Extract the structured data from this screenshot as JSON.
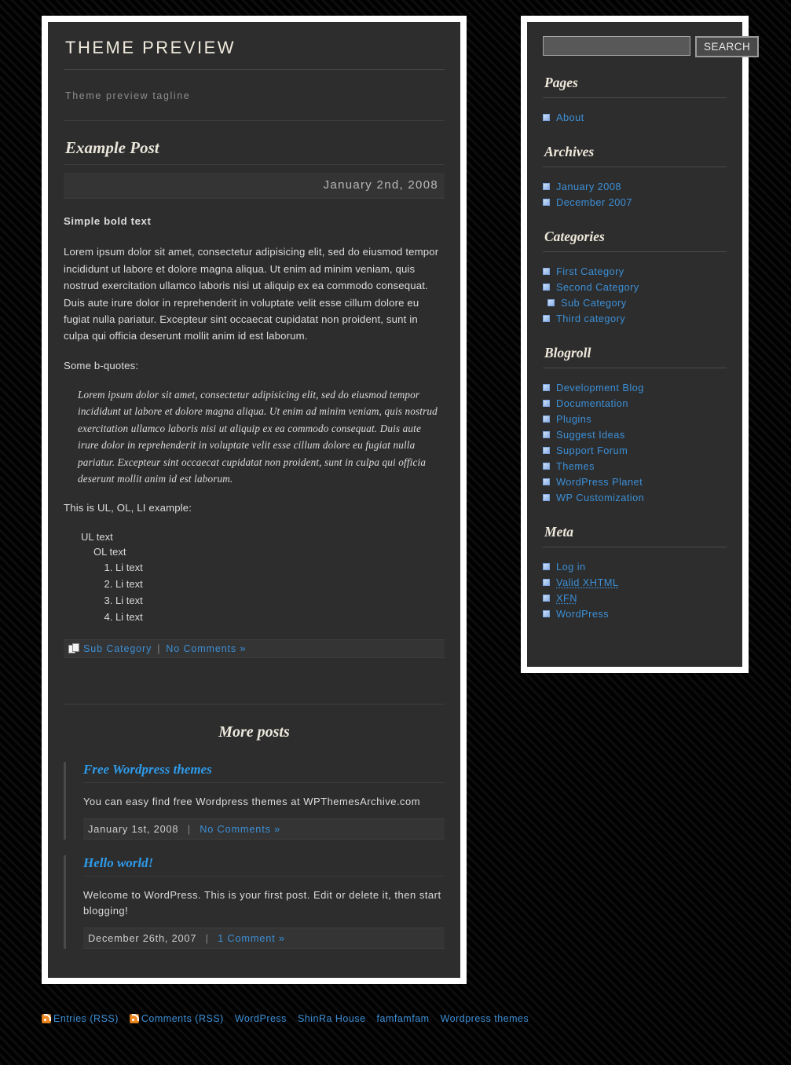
{
  "site": {
    "title": "THEME PREVIEW",
    "tagline": "Theme preview tagline"
  },
  "post": {
    "title": "Example Post",
    "date": "January 2nd, 2008",
    "bold_line": "Simple bold text",
    "paragraph": "Lorem ipsum dolor sit amet, consectetur adipisicing elit, sed do eiusmod tempor incididunt ut labore et dolore magna aliqua. Ut enim ad minim veniam, quis nostrud exercitation ullamco laboris nisi ut aliquip ex ea commodo consequat. Duis aute irure dolor in reprehenderit in voluptate velit esse cillum dolore eu fugiat nulla pariatur. Excepteur sint occaecat cupidatat non proident, sunt in culpa qui officia deserunt mollit anim id est laborum.",
    "quote_intro": "Some b-quotes:",
    "blockquote": "Lorem ipsum dolor sit amet, consectetur adipisicing elit, sed do eiusmod tempor incididunt ut labore et dolore magna aliqua. Ut enim ad minim veniam, quis nostrud exercitation ullamco laboris nisi ut aliquip ex ea commodo consequat. Duis aute irure dolor in reprehenderit in voluptate velit esse cillum dolore eu fugiat nulla pariatur. Excepteur sint occaecat cupidatat non proident, sunt in culpa qui officia deserunt mollit anim id est laborum.",
    "list_intro": "This is UL, OL, LI example:",
    "ul_text": "UL text",
    "ol_text": "OL text",
    "li_items": [
      "Li text",
      "Li text",
      "Li text",
      "Li text"
    ],
    "meta": {
      "category": "Sub Category",
      "separator": "|",
      "comments": "No Comments »"
    }
  },
  "more_posts": {
    "heading": "More posts",
    "items": [
      {
        "title": "Free Wordpress themes",
        "excerpt": "You can easy find free Wordpress themes at WPThemesArchive.com",
        "date": "January 1st, 2008",
        "separator": "|",
        "comments": "No Comments »"
      },
      {
        "title": "Hello world!",
        "excerpt": "Welcome to WordPress. This is your first post. Edit or delete it, then start blogging!",
        "date": "December 26th, 2007",
        "separator": "|",
        "comments": "1 Comment »"
      }
    ]
  },
  "sidebar": {
    "search": {
      "value": "",
      "placeholder": "",
      "button_label": "SEARCH"
    },
    "sections": [
      {
        "heading": "Pages",
        "items": [
          {
            "label": "About",
            "indent": false
          }
        ]
      },
      {
        "heading": "Archives",
        "items": [
          {
            "label": "January 2008",
            "indent": false
          },
          {
            "label": "December 2007",
            "indent": false
          }
        ]
      },
      {
        "heading": "Categories",
        "items": [
          {
            "label": "First Category",
            "indent": false
          },
          {
            "label": "Second Category",
            "indent": false
          },
          {
            "label": "Sub Category",
            "indent": true
          },
          {
            "label": "Third category",
            "indent": false
          }
        ]
      },
      {
        "heading": "Blogroll",
        "items": [
          {
            "label": "Development Blog",
            "indent": false
          },
          {
            "label": "Documentation",
            "indent": false
          },
          {
            "label": "Plugins",
            "indent": false
          },
          {
            "label": "Suggest Ideas",
            "indent": false
          },
          {
            "label": "Support Forum",
            "indent": false
          },
          {
            "label": "Themes",
            "indent": false
          },
          {
            "label": "WordPress Planet",
            "indent": false
          },
          {
            "label": "WP Customization",
            "indent": false
          }
        ]
      },
      {
        "heading": "Meta",
        "items": [
          {
            "label": "Log in",
            "indent": false,
            "abbr": false
          },
          {
            "label": "Valid XHTML",
            "indent": false,
            "abbr": true
          },
          {
            "label": "XFN",
            "indent": false,
            "abbr": true
          },
          {
            "label": "WordPress",
            "indent": false,
            "abbr": false
          }
        ]
      }
    ]
  },
  "footer": {
    "links": [
      {
        "label": "Entries (RSS)",
        "rss": true
      },
      {
        "label": "Comments (RSS)",
        "rss": true
      },
      {
        "label": "WordPress",
        "rss": false
      },
      {
        "label": "ShinRa House",
        "rss": false
      },
      {
        "label": "famfamfam",
        "rss": false
      },
      {
        "label": "Wordpress themes",
        "rss": false
      }
    ]
  },
  "colors": {
    "page_background": "#050505",
    "panel_background": "#2d2d2d",
    "frame": "#ffffff",
    "link": "#3c8fd6",
    "post_link": "#2e9bea",
    "heading": "#efe9dc",
    "rss_orange": "#f08a24",
    "bullet": "#8ab0e6"
  }
}
